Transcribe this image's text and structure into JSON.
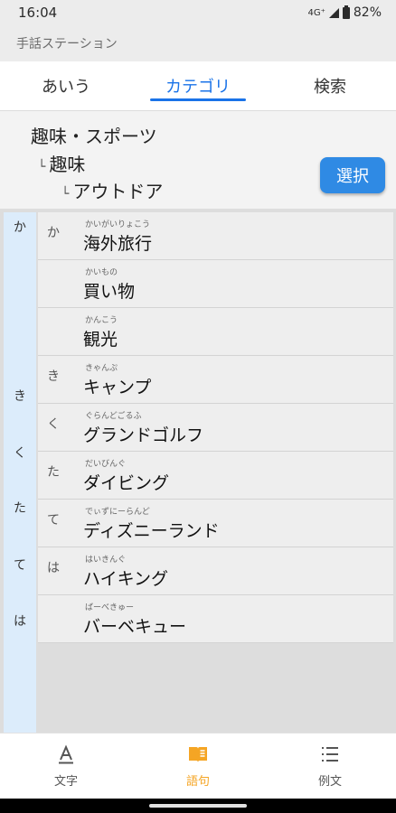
{
  "status_bar": {
    "time": "16:04",
    "network": "4G⁺",
    "battery": "82%"
  },
  "app_title": "手話ステーション",
  "tabs": [
    {
      "label": "あいう",
      "active": false
    },
    {
      "label": "カテゴリ",
      "active": true
    },
    {
      "label": "検索",
      "active": false
    }
  ],
  "breadcrumb": {
    "level1": "趣味・スポーツ",
    "level2": "趣味",
    "level3": "アウトドア",
    "branch_glyph": "└",
    "select_label": "選択"
  },
  "index_bar": [
    "か",
    "き",
    "く",
    "た",
    "て",
    "は"
  ],
  "words": [
    {
      "group": "か",
      "reading": "かいがいりょこう",
      "word": "海外旅行"
    },
    {
      "group": "",
      "reading": "かいもの",
      "word": "買い物"
    },
    {
      "group": "",
      "reading": "かんこう",
      "word": "観光"
    },
    {
      "group": "き",
      "reading": "きゃんぷ",
      "word": "キャンプ"
    },
    {
      "group": "く",
      "reading": "ぐらんどごるふ",
      "word": "グランドゴルフ"
    },
    {
      "group": "た",
      "reading": "だいびんぐ",
      "word": "ダイビング"
    },
    {
      "group": "て",
      "reading": "でぃずにーらんど",
      "word": "ディズニーランド"
    },
    {
      "group": "は",
      "reading": "はいきんぐ",
      "word": "ハイキング"
    },
    {
      "group": "",
      "reading": "ばーべきゅー",
      "word": "バーベキュー"
    }
  ],
  "bottom_nav": [
    {
      "label": "文字",
      "icon": "letter-a-icon",
      "active": false
    },
    {
      "label": "語句",
      "icon": "book-icon",
      "active": true
    },
    {
      "label": "例文",
      "icon": "list-icon",
      "active": false
    }
  ],
  "colors": {
    "accent": "#1a73e8",
    "select_button": "#2f8ae4",
    "nav_active": "#f5a524",
    "index_bar": "#dcecfb"
  }
}
